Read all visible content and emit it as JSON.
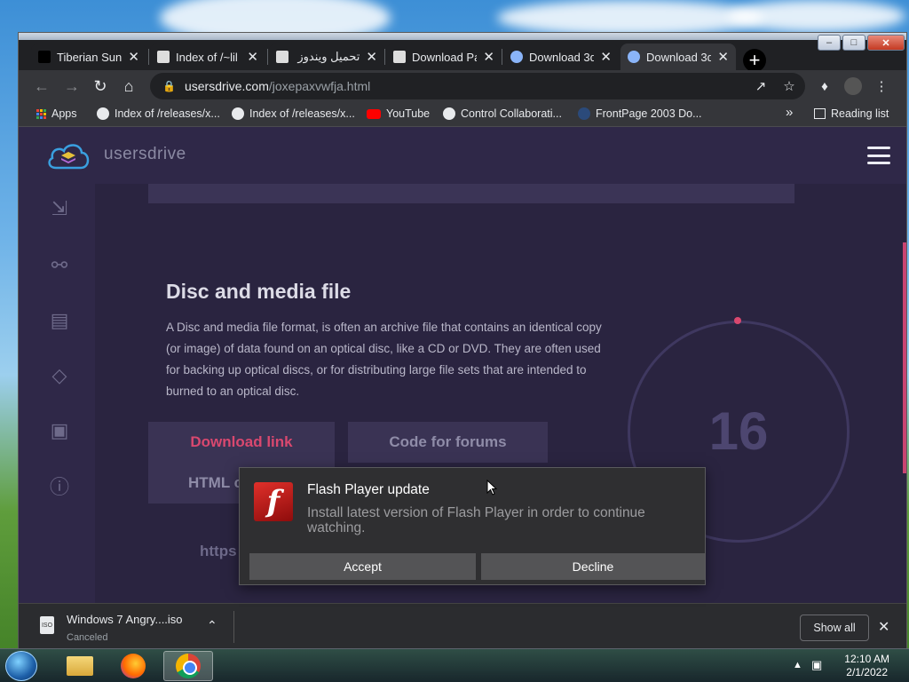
{
  "browser": {
    "tabs": [
      {
        "title": "Tiberian Sun",
        "favicon_color": "#000000"
      },
      {
        "title": "Index of /~lil",
        "favicon_color": "#dddddd"
      },
      {
        "title": "تحميل ويندوز",
        "favicon_color": "#dddddd"
      },
      {
        "title": "Download Pa",
        "favicon_color": "#dddddd"
      },
      {
        "title": "Download 3d",
        "favicon_color": "#8ab4f8"
      },
      {
        "title": "Download 3d",
        "favicon_color": "#8ab4f8"
      }
    ],
    "new_tab_label": "+",
    "url_host": "usersdrive.com",
    "url_path": "/joxepaxvwfja.html",
    "bookmarks": [
      {
        "label": "Apps"
      },
      {
        "label": "Index of /releases/x..."
      },
      {
        "label": "Index of /releases/x..."
      },
      {
        "label": "YouTube"
      },
      {
        "label": "Control Collaborati..."
      },
      {
        "label": "FrontPage 2003 Do..."
      }
    ],
    "bookmarks_overflow": "»",
    "reading_list": "Reading list"
  },
  "site": {
    "logo_text": "usersdrive",
    "section_title": "Disc and media file",
    "section_desc": "A Disc and media file format, is often an archive file that contains an identical copy (or image) of data found on an optical disc, like a CD or DVD. They are often used for backing up optical discs, or for distributing large file sets that are intended to burned to an optical disc.",
    "buttons": {
      "download_link": "Download link",
      "code_for_forums": "Code for forums",
      "html_code": "HTML c"
    },
    "countdown": "16",
    "link_text": "https"
  },
  "popup": {
    "title": "Flash Player update",
    "message": "Install latest version of Flash Player in order to continue watching.",
    "accept": "Accept",
    "decline": "Decline",
    "icon_letter": "f"
  },
  "download_bar": {
    "file_name": "Windows 7 Angry....iso",
    "status": "Canceled",
    "file_badge": "ISO",
    "show_all": "Show all"
  },
  "taskbar": {
    "time": "12:10 AM",
    "date": "2/1/2022"
  },
  "colors": {
    "accent_pink": "#d9486f",
    "page_bg": "#2b2541",
    "chrome_dark": "#202124"
  }
}
